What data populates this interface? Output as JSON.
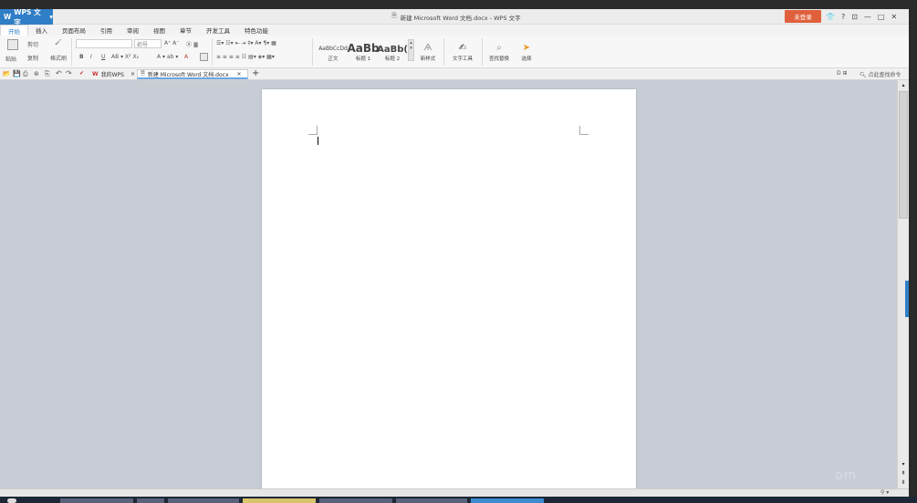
{
  "app": {
    "name": "WPS 文字",
    "doc_title": "新建 Microsoft Word 文档.docx - WPS 文字",
    "login": "未登录",
    "help": "?"
  },
  "colors": {
    "accent": "#2f7ec6",
    "login": "#e0603c",
    "canvas": "#c8ccd4",
    "page": "#ffffff"
  },
  "tabs": [
    "开始",
    "插入",
    "页面布局",
    "引用",
    "审阅",
    "视图",
    "章节",
    "开发工具",
    "特色功能"
  ],
  "active_tab": "开始",
  "ribbon": {
    "clipboard": {
      "paste": "粘贴",
      "cut": "剪切",
      "copy": "复制",
      "format_painter": "格式刷"
    },
    "font": {
      "name": "",
      "size": "初号"
    },
    "styles": [
      {
        "preview": "AaBbCcDd",
        "label": "正文"
      },
      {
        "preview": "AaBb",
        "label": "标题 1"
      },
      {
        "preview": "AaBb(",
        "label": "标题 2"
      }
    ],
    "new_style": "新样式",
    "text_tools": "文字工具",
    "find_replace": "查找替换",
    "select": "选择"
  },
  "doc_tabs": [
    "我的WPS",
    "新建 Microsoft Word 文档.docx"
  ],
  "search_cmd": "点此查找命令",
  "icons": [
    "wps-logo-icon",
    "close-icon",
    "minimize-icon",
    "maximize-icon",
    "shirt-icon",
    "open-icon",
    "save-icon",
    "print-icon",
    "undo-icon",
    "redo-icon",
    "add-tab-icon",
    "search-icon"
  ]
}
